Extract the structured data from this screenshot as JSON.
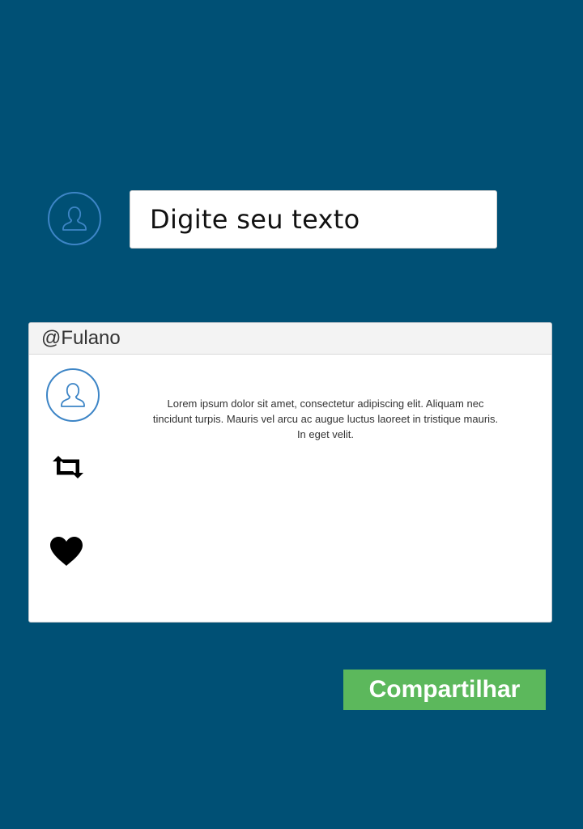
{
  "composer": {
    "avatar_icon": "user-icon",
    "input_value": "Digite seu texto"
  },
  "post": {
    "username": "@Fulano",
    "avatar_icon": "user-icon",
    "text": "Lorem ipsum dolor sit amet, consectetur adipiscing elit. Aliquam nec tincidunt turpis. Mauris vel arcu ac augue luctus laoreet in tristique mauris. In eget velit.",
    "actions": {
      "retweet_icon": "retweet-icon",
      "like_icon": "heart-icon"
    }
  },
  "share_button": {
    "label": "Compartilhar"
  },
  "colors": {
    "background": "#005075",
    "avatar_border": "#3d85c6",
    "share_button": "#5cb85c"
  }
}
